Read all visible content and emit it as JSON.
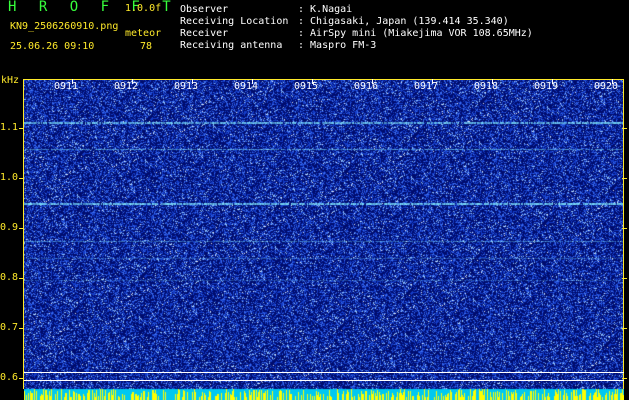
{
  "header": {
    "app_title": "HROFFT",
    "version": "1.0.0f",
    "filename": "KN9_2506260910.png",
    "station": "meteor",
    "timestamp": "25.06.26 09:10",
    "count": "78",
    "info": [
      {
        "label": "Observer",
        "value": ": K.Nagai"
      },
      {
        "label": "Receiving Location",
        "value": ": Chigasaki, Japan (139.414 35.340)"
      },
      {
        "label": "Receiver",
        "value": ": AirSpy mini (Miakejima VOR 108.65MHz)"
      },
      {
        "label": "Receiving antenna",
        "value": ": Maspro FM-3"
      }
    ]
  },
  "spectrogram": {
    "frequency_unit": "kHz",
    "frequency_axis": [
      "1.1",
      "1.0",
      "0.9",
      "0.8",
      "0.7",
      "0.6"
    ],
    "time_axis": [
      "0911",
      "0912",
      "0913",
      "0914",
      "0915",
      "0916",
      "0917",
      "0918",
      "0919",
      "0920"
    ],
    "colors": {
      "background": "#000000",
      "plot_background": "#00107a",
      "noise_low": "#1a3cd8",
      "noise_high": "#9fd4ff",
      "signal_line": "#7fe8ff",
      "axis_label": "#ffea2a",
      "title_green": "#37ff3c",
      "baseline_cyan": "#00e0ff",
      "baseline_yellow": "#ffff00"
    }
  }
}
